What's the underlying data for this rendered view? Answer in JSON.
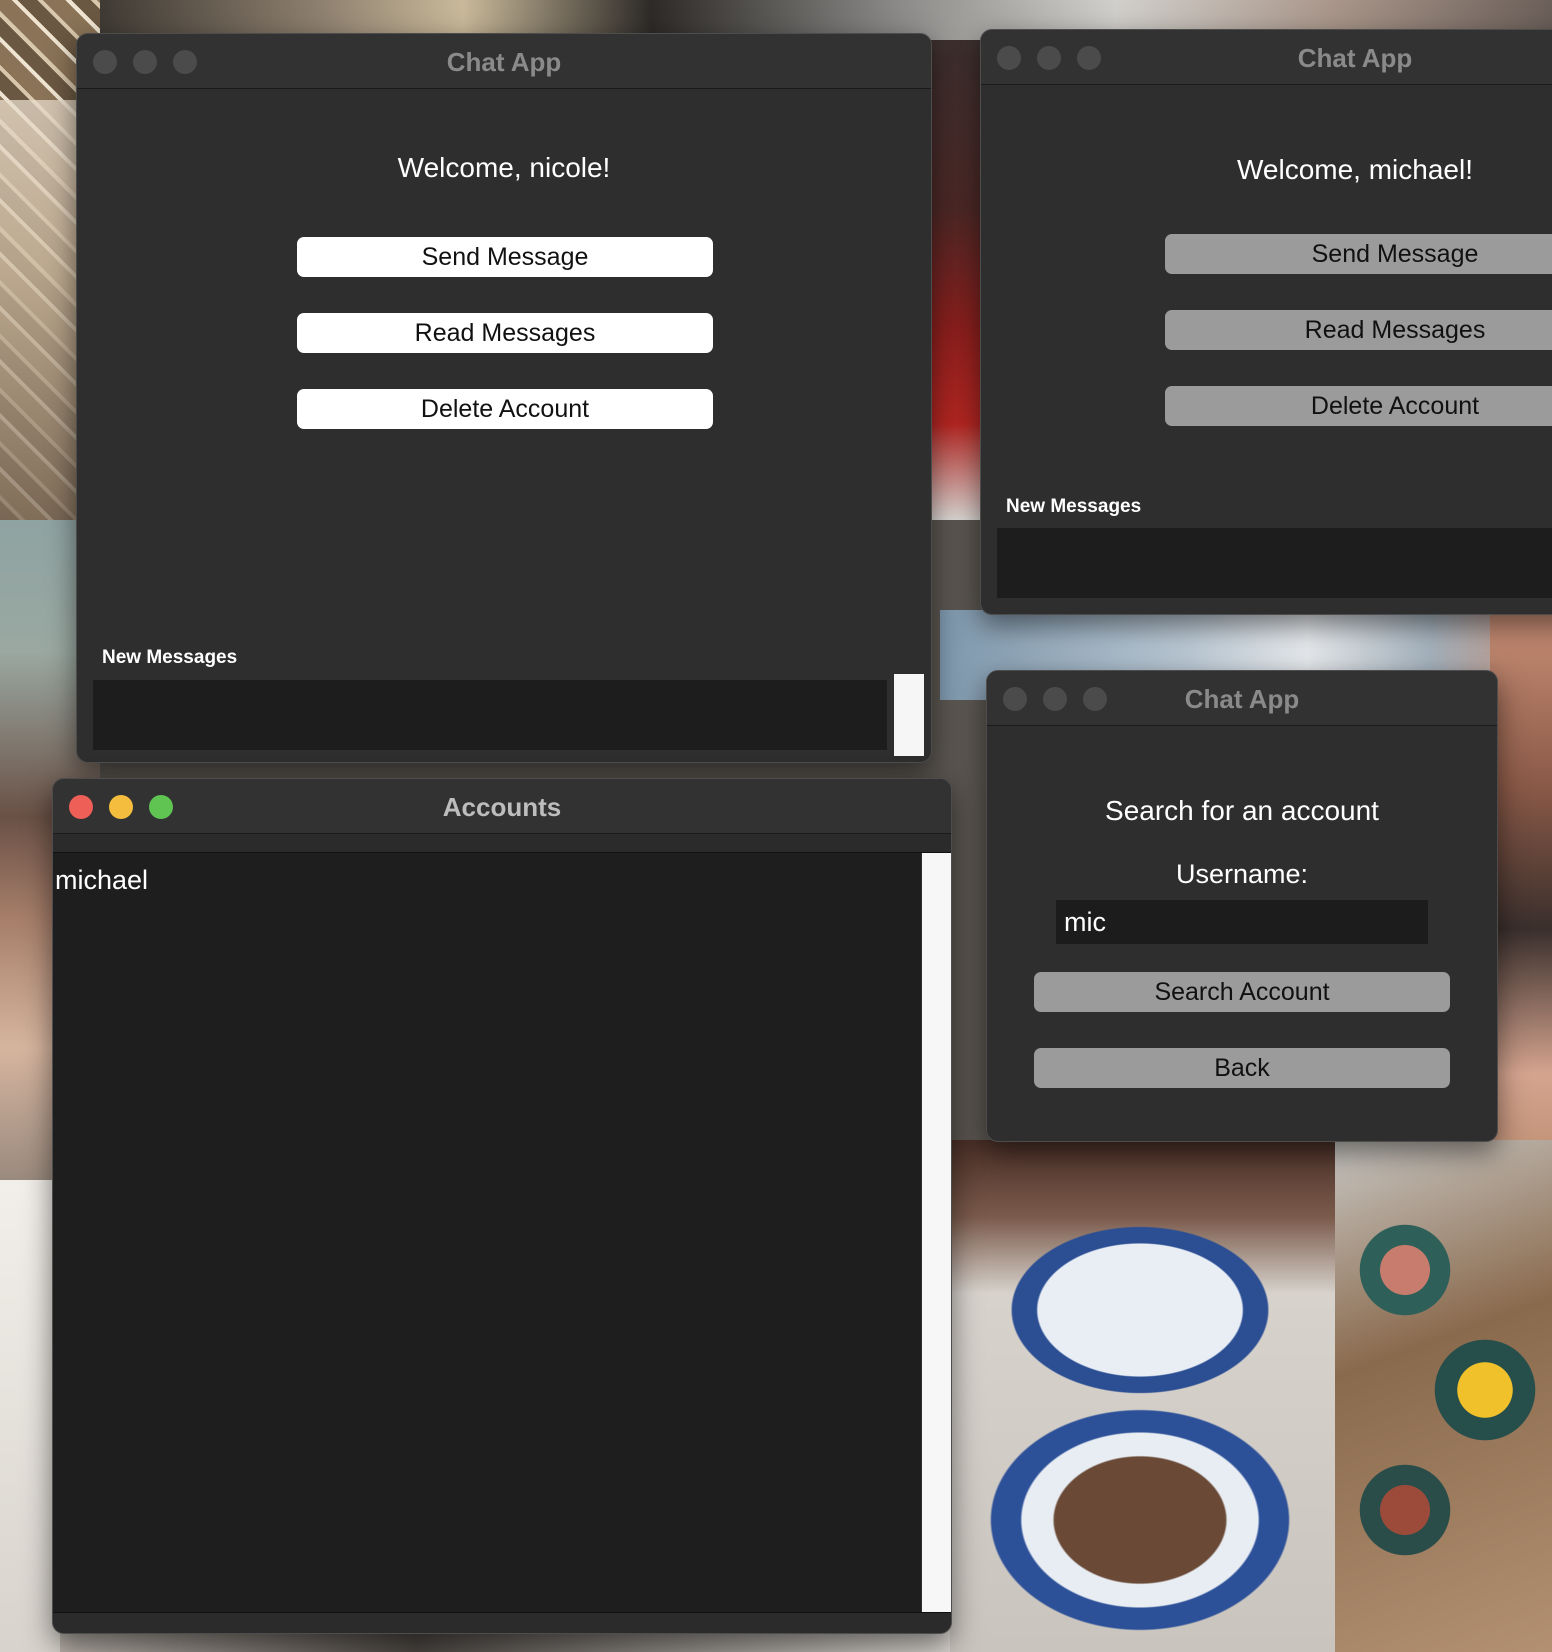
{
  "windows": {
    "nicole": {
      "title": "Chat App",
      "welcome": "Welcome, nicole!",
      "buttons": {
        "send": "Send Message",
        "read": "Read Messages",
        "delete": "Delete Account"
      },
      "new_messages_label": "New Messages",
      "new_messages": ""
    },
    "michael": {
      "title": "Chat App",
      "welcome": "Welcome, michael!",
      "buttons": {
        "send": "Send Message",
        "read": "Read Messages",
        "delete": "Delete Account"
      },
      "new_messages_label": "New Messages",
      "new_messages": ""
    },
    "search": {
      "title": "Chat App",
      "heading": "Search for an account",
      "username_label": "Username:",
      "username_value": "mic",
      "search_button": "Search Account",
      "back_button": "Back"
    },
    "accounts": {
      "title": "Accounts",
      "items": [
        "michael"
      ]
    }
  },
  "colors": {
    "window_bg": "#2e2e2e",
    "traffic_red": "#ed5f57",
    "traffic_yellow": "#f5bd3d",
    "traffic_green": "#5fc452",
    "button_active": "#ffffff",
    "button_inactive": "#9b9b9b"
  }
}
